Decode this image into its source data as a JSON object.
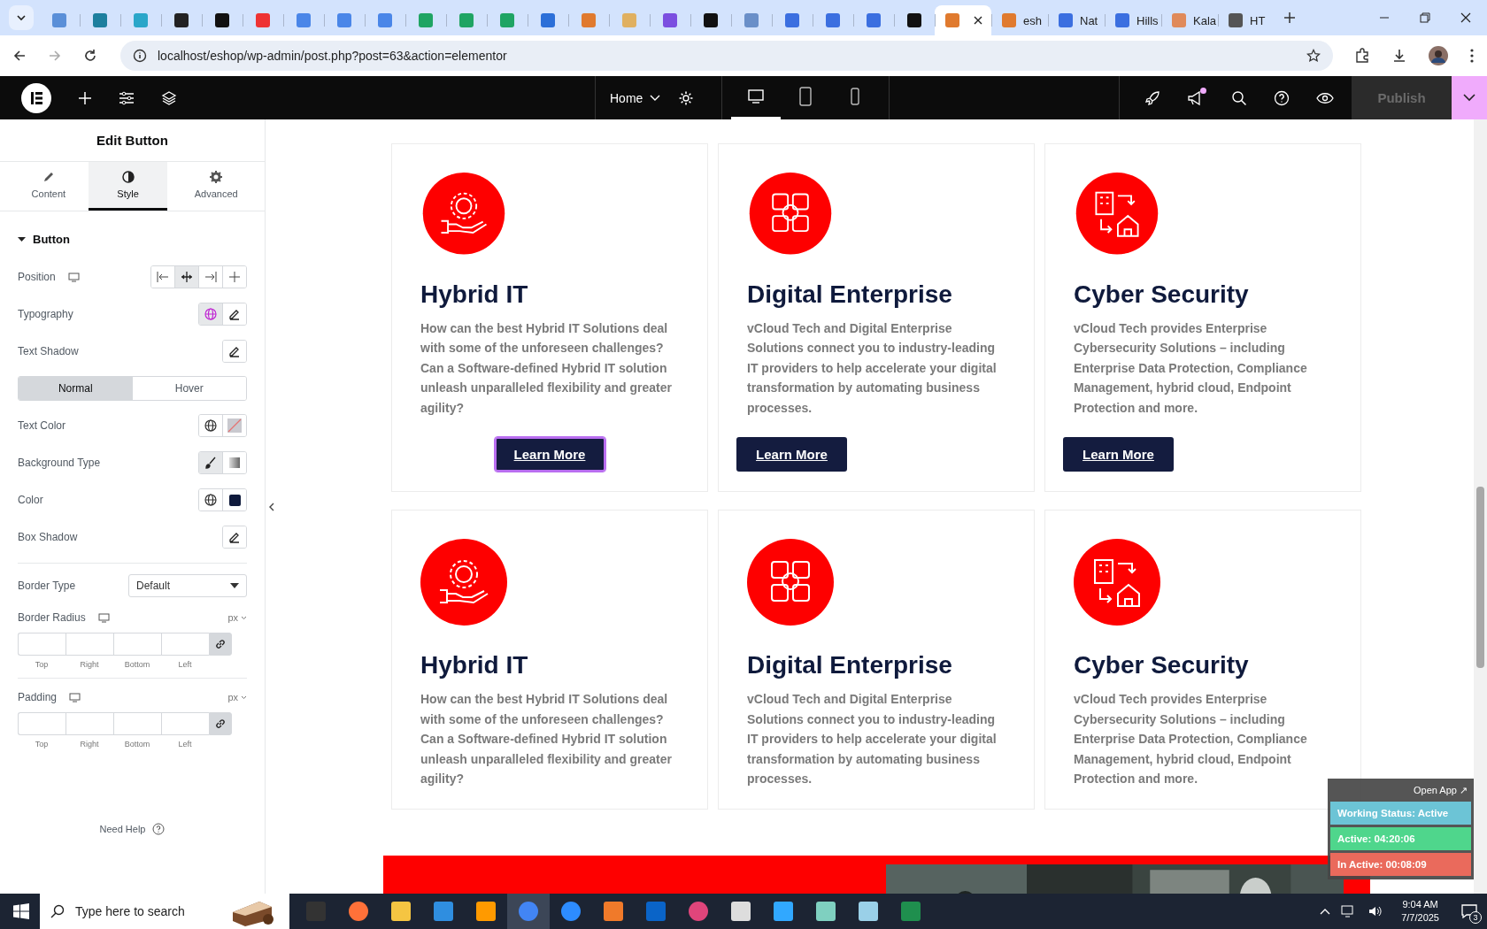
{
  "browser": {
    "tabs": [
      {
        "selected": false
      },
      {
        "selected": false
      },
      {
        "selected": false
      },
      {
        "selected": false
      },
      {
        "selected": false
      },
      {
        "selected": false
      },
      {
        "selected": false
      },
      {
        "selected": false
      },
      {
        "selected": false
      },
      {
        "selected": false
      },
      {
        "selected": false
      },
      {
        "selected": false
      },
      {
        "selected": false
      },
      {
        "selected": false
      },
      {
        "selected": false
      },
      {
        "selected": false
      },
      {
        "selected": false
      },
      {
        "selected": false
      },
      {
        "selected": false
      },
      {
        "selected": false
      },
      {
        "selected": false
      },
      {
        "selected": false
      },
      {
        "selected": true
      },
      {
        "selected": false,
        "title": "esh"
      },
      {
        "selected": false,
        "title": "Nat"
      },
      {
        "selected": false,
        "title": "Hills"
      },
      {
        "selected": false,
        "title": "Kala"
      },
      {
        "selected": false,
        "title": "HT"
      }
    ],
    "url": "localhost/eshop/wp-admin/post.php?post=63&action=elementor"
  },
  "editor_bar": {
    "page": "Home",
    "devices": [
      {
        "selected": true
      },
      {
        "selected": false
      },
      {
        "selected": false
      }
    ],
    "notification_dot": true,
    "publish": {
      "label": "Publish",
      "disabled": true
    }
  },
  "panel": {
    "title": "Edit Button",
    "tabs": [
      {
        "label": "Content",
        "selected": false
      },
      {
        "label": "Style",
        "selected": true
      },
      {
        "label": "Advanced",
        "selected": false
      }
    ],
    "section": {
      "label": "Button",
      "expanded": true
    },
    "controls": [
      {
        "kind": "buttons",
        "label": "Position",
        "responsive": true,
        "buttons": [
          {
            "kind": "align-start",
            "selected": false
          },
          {
            "kind": "align-center",
            "selected": true
          },
          {
            "kind": "align-end",
            "selected": false
          },
          {
            "kind": "align-stretch",
            "selected": false
          }
        ]
      },
      {
        "kind": "buttons",
        "label": "Typography",
        "buttons": [
          {
            "kind": "globe",
            "selected": true
          },
          {
            "kind": "pencil",
            "selected": false
          }
        ]
      },
      {
        "kind": "buttons",
        "label": "Text Shadow",
        "buttons": [
          {
            "kind": "pencil",
            "selected": false
          }
        ]
      },
      {
        "kind": "toggle",
        "options": [
          {
            "label": "Normal",
            "selected": true
          },
          {
            "label": "Hover",
            "selected": false
          }
        ]
      },
      {
        "kind": "buttons",
        "label": "Text Color",
        "buttons": [
          {
            "kind": "globe",
            "selected": false
          },
          {
            "kind": "no-color",
            "selected": false
          }
        ]
      },
      {
        "kind": "buttons",
        "label": "Background Type",
        "buttons": [
          {
            "kind": "brush",
            "selected": true
          },
          {
            "kind": "gradient",
            "selected": false
          }
        ]
      },
      {
        "kind": "buttons",
        "label": "Color",
        "buttons": [
          {
            "kind": "globe",
            "selected": false
          },
          {
            "kind": "swatch",
            "selected": false,
            "color": "#0f1a3c"
          }
        ]
      },
      {
        "kind": "buttons",
        "label": "Box Shadow",
        "buttons": [
          {
            "kind": "pencil",
            "selected": false
          }
        ]
      },
      {
        "kind": "select",
        "label": "Border Type",
        "value": "Default"
      },
      {
        "kind": "dimensions",
        "label": "Border Radius",
        "responsive": true,
        "unit": "px",
        "sides": [
          "Top",
          "Right",
          "Bottom",
          "Left"
        ],
        "linked": true
      },
      {
        "kind": "dimensions",
        "label": "Padding",
        "responsive": true,
        "unit": "px",
        "sides": [
          "Top",
          "Right",
          "Bottom",
          "Left"
        ],
        "linked": true
      }
    ],
    "help": "Need Help"
  },
  "cards": [
    {
      "title": "Hybrid IT",
      "text": "How can the best Hybrid IT Solutions deal with some of the unforeseen challenges? Can a Software-defined Hybrid IT solution unleash unparalleled flexibility and greater agility?",
      "button": {
        "label": "Learn More",
        "centered": true,
        "selected": true
      }
    },
    {
      "title": "Digital Enterprise",
      "text": "vCloud Tech and Digital Enterprise Solutions connect you to industry-leading IT providers to help accelerate your digital transformation by automating business processes.",
      "button": {
        "label": "Learn More",
        "centered": false,
        "selected": false
      }
    },
    {
      "title": "Cyber Security",
      "text": "vCloud Tech provides Enterprise Cybersecurity Solutions – including Enterprise Data Protection, Compliance Management, hybrid cloud, Endpoint Protection and more.",
      "button": {
        "label": "Learn More",
        "centered": false,
        "selected": false
      }
    },
    {
      "title": "Hybrid IT",
      "text": "How can the best Hybrid IT Solutions deal with some of the unforeseen challenges? Can a Software-defined Hybrid IT solution unleash unparalleled flexibility and greater agility?"
    },
    {
      "title": "Digital Enterprise",
      "text": "vCloud Tech and Digital Enterprise Solutions connect you to industry-leading IT providers to help accelerate your digital transformation by automating business processes."
    },
    {
      "title": "Cyber Security",
      "text": "vCloud Tech provides Enterprise Cybersecurity Solutions – including Enterprise Data Protection, Compliance Management, hybrid cloud, Endpoint Protection and more."
    }
  ],
  "tracker": {
    "open_app": "Open App ↗",
    "items": [
      {
        "text": "Working Status: Active",
        "color": "#6cc4d6"
      },
      {
        "text": "Active: 04:20:06",
        "color": "#4fd68c"
      },
      {
        "text": "In Active: 00:08:09",
        "color": "#ea6a5c"
      }
    ]
  },
  "taskbar": {
    "search_placeholder": "Type here to search",
    "apps": [
      {
        "selected": false
      },
      {
        "selected": false
      },
      {
        "selected": false
      },
      {
        "selected": false
      },
      {
        "selected": false
      },
      {
        "selected": true
      },
      {
        "selected": false
      },
      {
        "selected": false
      },
      {
        "selected": false
      },
      {
        "selected": false
      },
      {
        "selected": false
      },
      {
        "selected": false
      },
      {
        "selected": false
      },
      {
        "selected": false
      },
      {
        "selected": false
      }
    ],
    "time": "9:04 AM",
    "date": "7/7/2025",
    "notifications": "3"
  }
}
